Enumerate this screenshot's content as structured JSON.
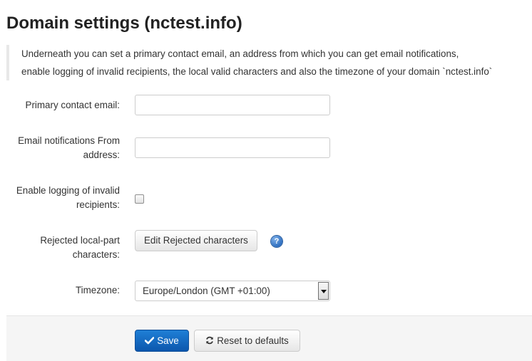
{
  "page": {
    "title": "Domain settings (nctest.info)"
  },
  "intro": {
    "line1": "Underneath you can set a primary contact email, an address from which you can get email notifications,",
    "line2": "enable logging of invalid recipients, the local valid characters and also the timezone of your domain `nctest.info`"
  },
  "form": {
    "primary_email": {
      "label": "Primary contact email:",
      "value": ""
    },
    "notification_from": {
      "label_line1": "Email notifications From",
      "label_line2": "address:",
      "value": ""
    },
    "log_invalid": {
      "label_line1": "Enable logging of invalid",
      "label_line2": "recipients:",
      "checked": false
    },
    "rejected_chars": {
      "label_line1": "Rejected local-part",
      "label_line2": "characters:",
      "button_label": "Edit Rejected characters",
      "help_glyph": "?",
      "help_icon": "help-icon"
    },
    "timezone": {
      "label": "Timezone:",
      "value": "Europe/London (GMT +01:00)"
    }
  },
  "footer": {
    "save_label": "Save",
    "save_icon": "check-icon",
    "reset_label": "Reset to defaults",
    "reset_icon": "refresh-icon"
  },
  "colors": {
    "primary_button": "#1468c4",
    "help_icon": "#2f6fc0",
    "footer_bg": "#f5f5f5"
  }
}
